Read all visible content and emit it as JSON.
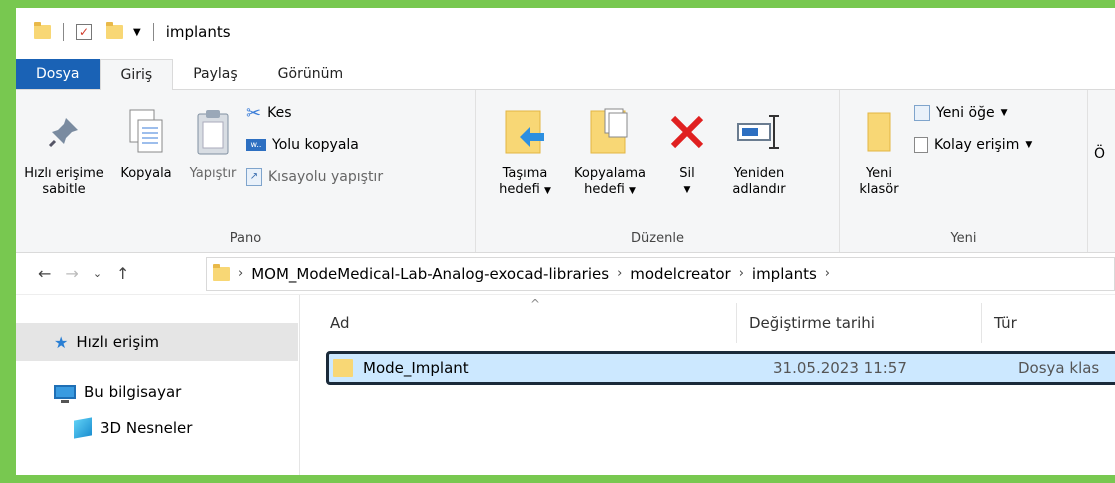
{
  "window": {
    "title": "implants"
  },
  "tabs": [
    {
      "label": "Dosya"
    },
    {
      "label": "Giriş"
    },
    {
      "label": "Paylaş"
    },
    {
      "label": "Görünüm"
    }
  ],
  "ribbon": {
    "pano": {
      "label": "Pano",
      "pin": {
        "line1": "Hızlı erişime",
        "line2": "sabitle"
      },
      "copy": "Kopyala",
      "paste": "Yapıştır",
      "cut": "Kes",
      "copy_path": "Yolu kopyala",
      "paste_shortcut": "Kısayolu yapıştır"
    },
    "duzenle": {
      "label": "Düzenle",
      "move_to": {
        "line1": "Taşıma",
        "line2": "hedefi"
      },
      "copy_to": {
        "line1": "Kopyalama",
        "line2": "hedefi"
      },
      "delete": "Sil",
      "rename": {
        "line1": "Yeniden",
        "line2": "adlandır"
      }
    },
    "yeni": {
      "label": "Yeni",
      "new_folder": {
        "line1": "Yeni",
        "line2": "klasör"
      },
      "new_item": "Yeni öğe",
      "easy_access": "Kolay erişim"
    },
    "overflow_char": "Ö"
  },
  "address": {
    "path": [
      "MOM_ModeMedical-Lab-Analog-exocad-libraries",
      "modelcreator",
      "implants"
    ]
  },
  "nav": {
    "quick_access": "Hızlı erişim",
    "this_pc": "Bu bilgisayar",
    "objects3d": "3D Nesneler"
  },
  "columns": {
    "name": "Ad",
    "date": "Değiştirme tarihi",
    "type": "Tür"
  },
  "files": [
    {
      "name": "Mode_Implant",
      "date": "31.05.2023 11:57",
      "type": "Dosya klas"
    }
  ]
}
